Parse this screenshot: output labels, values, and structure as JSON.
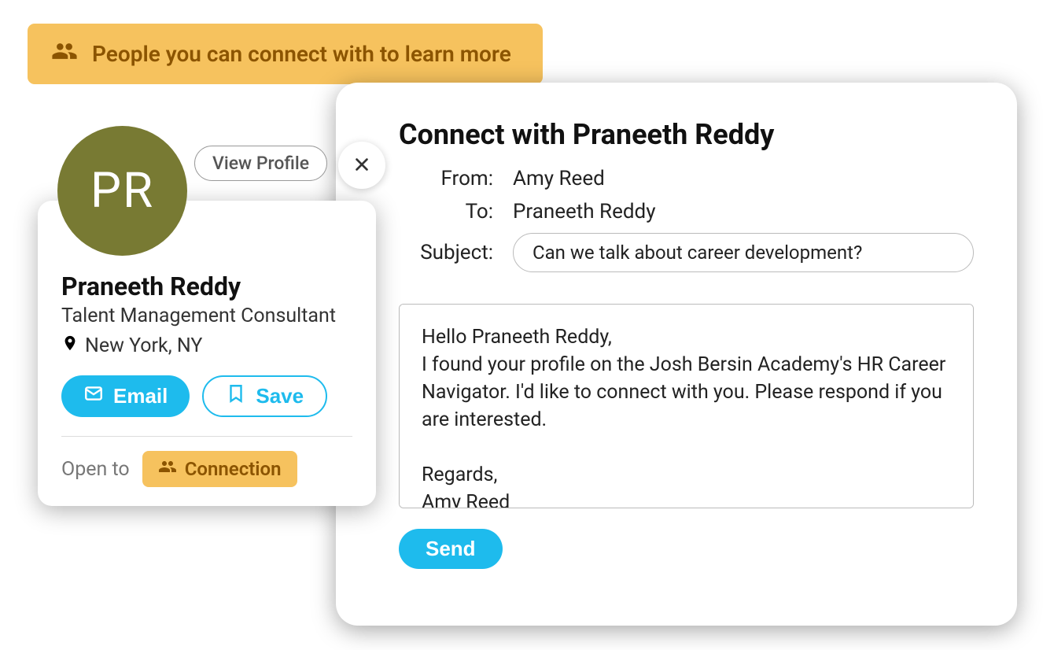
{
  "banner": {
    "text": "People you can connect with to learn more"
  },
  "profile": {
    "initials": "PR",
    "name": "Praneeth Reddy",
    "title": "Talent Management Consultant",
    "location": "New York, NY",
    "view_profile_label": "View Profile",
    "email_label": "Email",
    "save_label": "Save",
    "open_to_label": "Open to",
    "connection_badge": "Connection"
  },
  "compose": {
    "title": "Connect with Praneeth Reddy",
    "from_label": "From:",
    "from_value": "Amy Reed",
    "to_label": "To:",
    "to_value": "Praneeth Reddy",
    "subject_label": "Subject:",
    "subject_value": "Can we talk about career development?",
    "message": "Hello Praneeth Reddy,\nI found your profile on the Josh Bersin Academy's HR Career Navigator. I'd like to connect with you. Please respond if you are interested.\n\nRegards,\nAmy Reed",
    "send_label": "Send"
  }
}
